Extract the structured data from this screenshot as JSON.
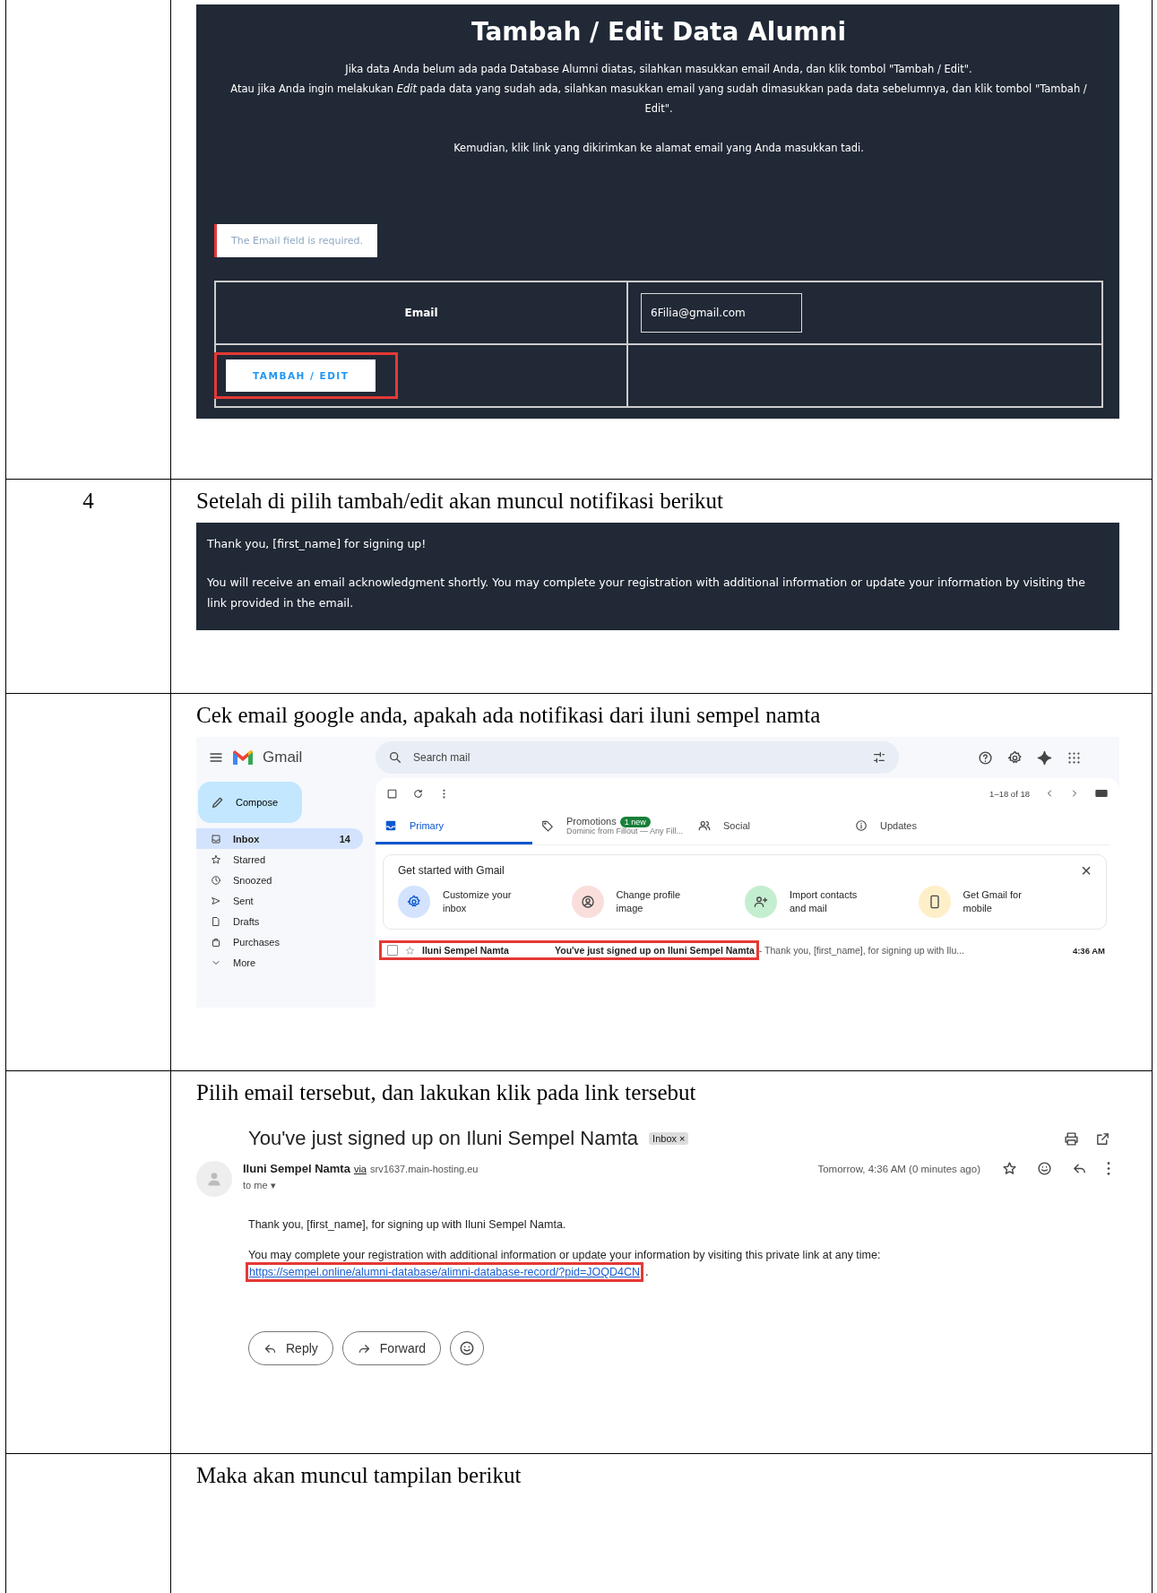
{
  "steps": [
    {
      "kind": "form",
      "form": {
        "title": "Tambah / Edit Data Alumni",
        "paragraphs": [
          "Jika data Anda belum ada pada Database Alumni diatas, silahkan masukkan email Anda, dan klik tombol \"Tambah / Edit\".",
          "Atau jika Anda ingin melakukan *Edit* pada data yang sudah ada, silahkan masukkan email yang sudah dimasukkan pada data sebelumnya, dan klik tombol \"Tambah / Edit\".",
          "Kemudian, klik link yang dikirimkan ke alamat email yang Anda masukkan tadi."
        ],
        "error": "The Email field is required.",
        "field_label": "Email",
        "field_value": "6Filia@gmail.com",
        "button": {
          "label": "TAMBAH / EDIT",
          "highlighted": true
        }
      }
    },
    {
      "kind": "notice",
      "number": "4",
      "instruction": "Setelah di pilih tambah/edit akan muncul notifikasi berikut",
      "notice": {
        "heading": "Thank you, [first_name] for signing up!",
        "body": "You will receive an email acknowledgment shortly. You may complete your registration with additional information or update your information by visiting the link provided in the email."
      }
    },
    {
      "kind": "inbox",
      "instruction": "Cek email google anda, apakah ada notifikasi dari iluni sempel namta",
      "inbox": {
        "app_name": "Gmail",
        "search_placeholder": "Search mail",
        "compose": "Compose",
        "nav": [
          {
            "label": "Inbox",
            "count": "14",
            "selected": true
          },
          {
            "label": "Starred",
            "selected": false
          },
          {
            "label": "Snoozed",
            "selected": false
          },
          {
            "label": "Sent",
            "selected": false
          },
          {
            "label": "Drafts",
            "selected": false
          },
          {
            "label": "Purchases",
            "selected": false
          },
          {
            "label": "More",
            "selected": false
          }
        ],
        "pagination": "1–18 of 18",
        "tabs": [
          {
            "label": "Primary",
            "selected": true
          },
          {
            "label": "Promotions",
            "badge": "1 new",
            "subtitle": "Dominic from Fillout — Any Fill...",
            "selected": false
          },
          {
            "label": "Social",
            "selected": false
          },
          {
            "label": "Updates",
            "selected": false
          }
        ],
        "get_started": {
          "title": "Get started with Gmail",
          "close": "×",
          "items": [
            {
              "label": "Customize your inbox",
              "color": "#d3e3fd"
            },
            {
              "label": "Change profile image",
              "color": "#f9dedc"
            },
            {
              "label": "Import contacts and mail",
              "color": "#c4eed0"
            },
            {
              "label": "Get Gmail for mobile",
              "color": "#ffefc9"
            }
          ]
        },
        "messages": [
          {
            "sender": "Iluni Sempel Namta",
            "subject": "You've just signed up on Iluni Sempel Namta",
            "snippet": " - Thank you, [first_name], for signing up with Ilu...",
            "time": "4:36 AM",
            "highlighted": true
          }
        ]
      }
    },
    {
      "kind": "message",
      "instruction": "Pilih email tersebut, dan lakukan klik pada link tersebut",
      "message": {
        "subject": "You've just signed up on Iluni Sempel Namta",
        "label": "Inbox",
        "label_close": "×",
        "sender": "Iluni Sempel Namta",
        "via": "via",
        "domain": "srv1637.main-hosting.eu",
        "recipient": "to me",
        "recipient_caret": "▾",
        "date": "Tomorrow, 4:36 AM (0 minutes ago)",
        "greeting": "Thank you, [first_name], for signing up with Iluni Sempel Namta.",
        "body": "You may complete your registration with additional information or update your information by visiting this private link at any time:",
        "link": {
          "text": "https://sempel.online/alumni-database/alimni-database-record/?pid=JOQD4CN",
          "highlighted": true
        },
        "after_link": ".",
        "buttons": [
          "Reply",
          "Forward"
        ]
      }
    },
    {
      "kind": "blank",
      "instruction": "Maka akan muncul tampilan berikut"
    }
  ]
}
